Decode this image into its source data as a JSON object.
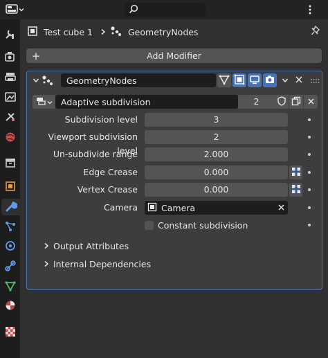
{
  "header": {
    "search_placeholder": ""
  },
  "breadcrumb": {
    "object": "Test cube 1",
    "modifier": "GeometryNodes"
  },
  "add_modifier": {
    "label": "Add Modifier"
  },
  "modifier": {
    "name": "GeometryNodes",
    "node_group": {
      "name": "Adaptive subdivision",
      "users": "2"
    },
    "fields": [
      {
        "label": "Subdivision level",
        "value": "3"
      },
      {
        "label": "Viewport subdivision level",
        "value": "2"
      },
      {
        "label": "Un-subdivide range",
        "value": "2.000"
      },
      {
        "label": "Edge Crease",
        "value": "0.000"
      },
      {
        "label": "Vertex Crease",
        "value": "0.000"
      }
    ],
    "camera": {
      "label": "Camera",
      "value": "Camera"
    },
    "constant": {
      "label": "Constant subdivision",
      "checked": false
    },
    "subpanels": [
      "Output Attributes",
      "Internal Dependencies"
    ]
  },
  "colors": {
    "accent": "#4772b3",
    "panel_bg": "#3d3d3d",
    "field_bg": "#545454",
    "dark_field": "#1d1d1d"
  }
}
